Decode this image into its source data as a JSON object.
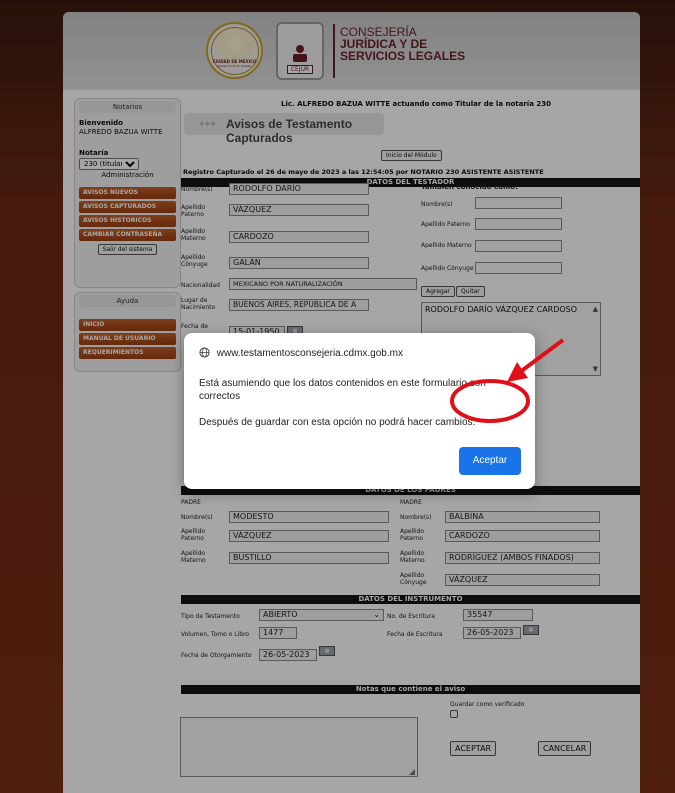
{
  "header": {
    "logo_cdmx_line1": "CIUDAD DE MÉXICO",
    "logo_cdmx_line2": "Gobierno de la Ciudad",
    "logo_cejur_label": "CEJUR",
    "org_line1": "CONSEJERÍA",
    "org_line2": "JURÍDICA Y DE",
    "org_line3": "SERVICIOS LEGALES"
  },
  "sidebar": {
    "notarios_title": "Notarios",
    "welcome_label": "Bienvenido",
    "user_name": "ALFREDO BAZUA WITTE",
    "notaria_label": "Notaría",
    "notaria_value": "230 (titular)",
    "admin_label": "Administración",
    "nav": [
      "AVISOS NUEVOS",
      "AVISOS CAPTURADOS",
      "AVISOS HISTORICOS",
      "CAMBIAR CONTRASEÑA"
    ],
    "logout_label": "Salir del sistema",
    "ayuda_title": "Ayuda",
    "help_nav": [
      "INICIO",
      "MANUAL DE USUARIO",
      "REQUERIMIENTOS"
    ]
  },
  "main": {
    "notary_line": "Lic. ALFREDO BAZUA WITTE actuando como Titular de la notaría 230",
    "page_title": "Avisos de Testamento Capturados",
    "inicio_label": "Inicio del Módulo",
    "registro": "Registro Capturado el 26 de mayo de 2023 a las 12:54:05 por NOTARIO 230 ASISTENTE ASISTENTE",
    "sec_testador": "DATOS DEL TESTADOR",
    "testador": {
      "nombre_label": "Nombre(s)",
      "nombre": "RODOLFO DARÍO",
      "paterno_label": "Apellido Paterno",
      "paterno": "VÁZQUEZ",
      "materno_label": "Apellido Materno",
      "materno": "CARDOZO",
      "conyuge_label": "Apellido Cónyuge",
      "conyuge": "GALÁN",
      "nacionalidad_label": "Nacionalidad",
      "nacionalidad": "MEXICANO POR NATURALIZACIÓN",
      "lugar_label": "Lugar de Nacimiento",
      "lugar": "BUENOS AIRES, REPÚBLICA DE A",
      "fecha_label": "Fecha de",
      "fecha": "15-01-1950"
    },
    "conocido": {
      "title": "También conocido como:",
      "nombre_label": "Nombre(s)",
      "paterno_label": "Apellido Paterno",
      "materno_label": "Apellido Materno",
      "conyuge_label": "Apellido Cónyuge",
      "agregar": "Agregar",
      "quitar": "Quitar",
      "list_value": "RODOLFO DARÍO VÁZQUEZ CARDOSO"
    },
    "sec_padres": "DATOS DE LOS PADRES",
    "padre": {
      "title": "PADRE",
      "nombre_label": "Nombre(s)",
      "nombre": "MODESTO",
      "paterno_label": "Apellido Paterno",
      "paterno": "VÁZQUEZ",
      "materno_label": "Apellido Materno",
      "materno": "BUSTILLO"
    },
    "madre": {
      "title": "MADRE",
      "nombre_label": "Nombre(s)",
      "nombre": "BALBINA",
      "paterno_label": "Apellido Paterno",
      "paterno": "CARDOZO",
      "materno_label": "Apellido Materno",
      "materno": "RODRÍGUEZ (AMBOS FINADOS)",
      "conyuge_label": "Apellido Cónyuge",
      "conyuge": "VÁZQUEZ"
    },
    "sec_instrumento": "DATOS DEL INSTRUMENTO",
    "instrumento": {
      "tipo_label": "Tipo de Testamento",
      "tipo": "ABIERTO",
      "escritura_label": "No. de Escritura",
      "escritura": "35547",
      "volumen_label": "Volumen, Tomo o Libro",
      "volumen": "1477",
      "fecha_escritura_label": "Fecha de Escritura",
      "fecha_escritura": "26-05-2023",
      "otorgamiento_label": "Fecha de Otorgamiento",
      "otorgamiento": "26-05-2023"
    },
    "sec_notas": "Notas que contiene el aviso",
    "verificado_label": "Guardar como verificado",
    "aceptar_label": "ACEPTAR",
    "cancelar_label": "CANCELAR"
  },
  "dialog": {
    "site": "www.testamentosconsejeria.cdmx.gob.mx",
    "message1": "Está asumiendo que los datos contenidos en este formulario son correctos",
    "message2": "Después de guardar con esta opción no podrá hacer cambios.",
    "ok_label": "Aceptar"
  },
  "colors": {
    "nav_button": "#b04f1d",
    "section_bar": "#151515",
    "dialog_button": "#1a73e8",
    "annotation": "#e0101a"
  },
  "icons": [
    "globe-icon",
    "calendar-icon",
    "chevron-down-icon",
    "scroll-up-icon",
    "scroll-down-icon"
  ]
}
